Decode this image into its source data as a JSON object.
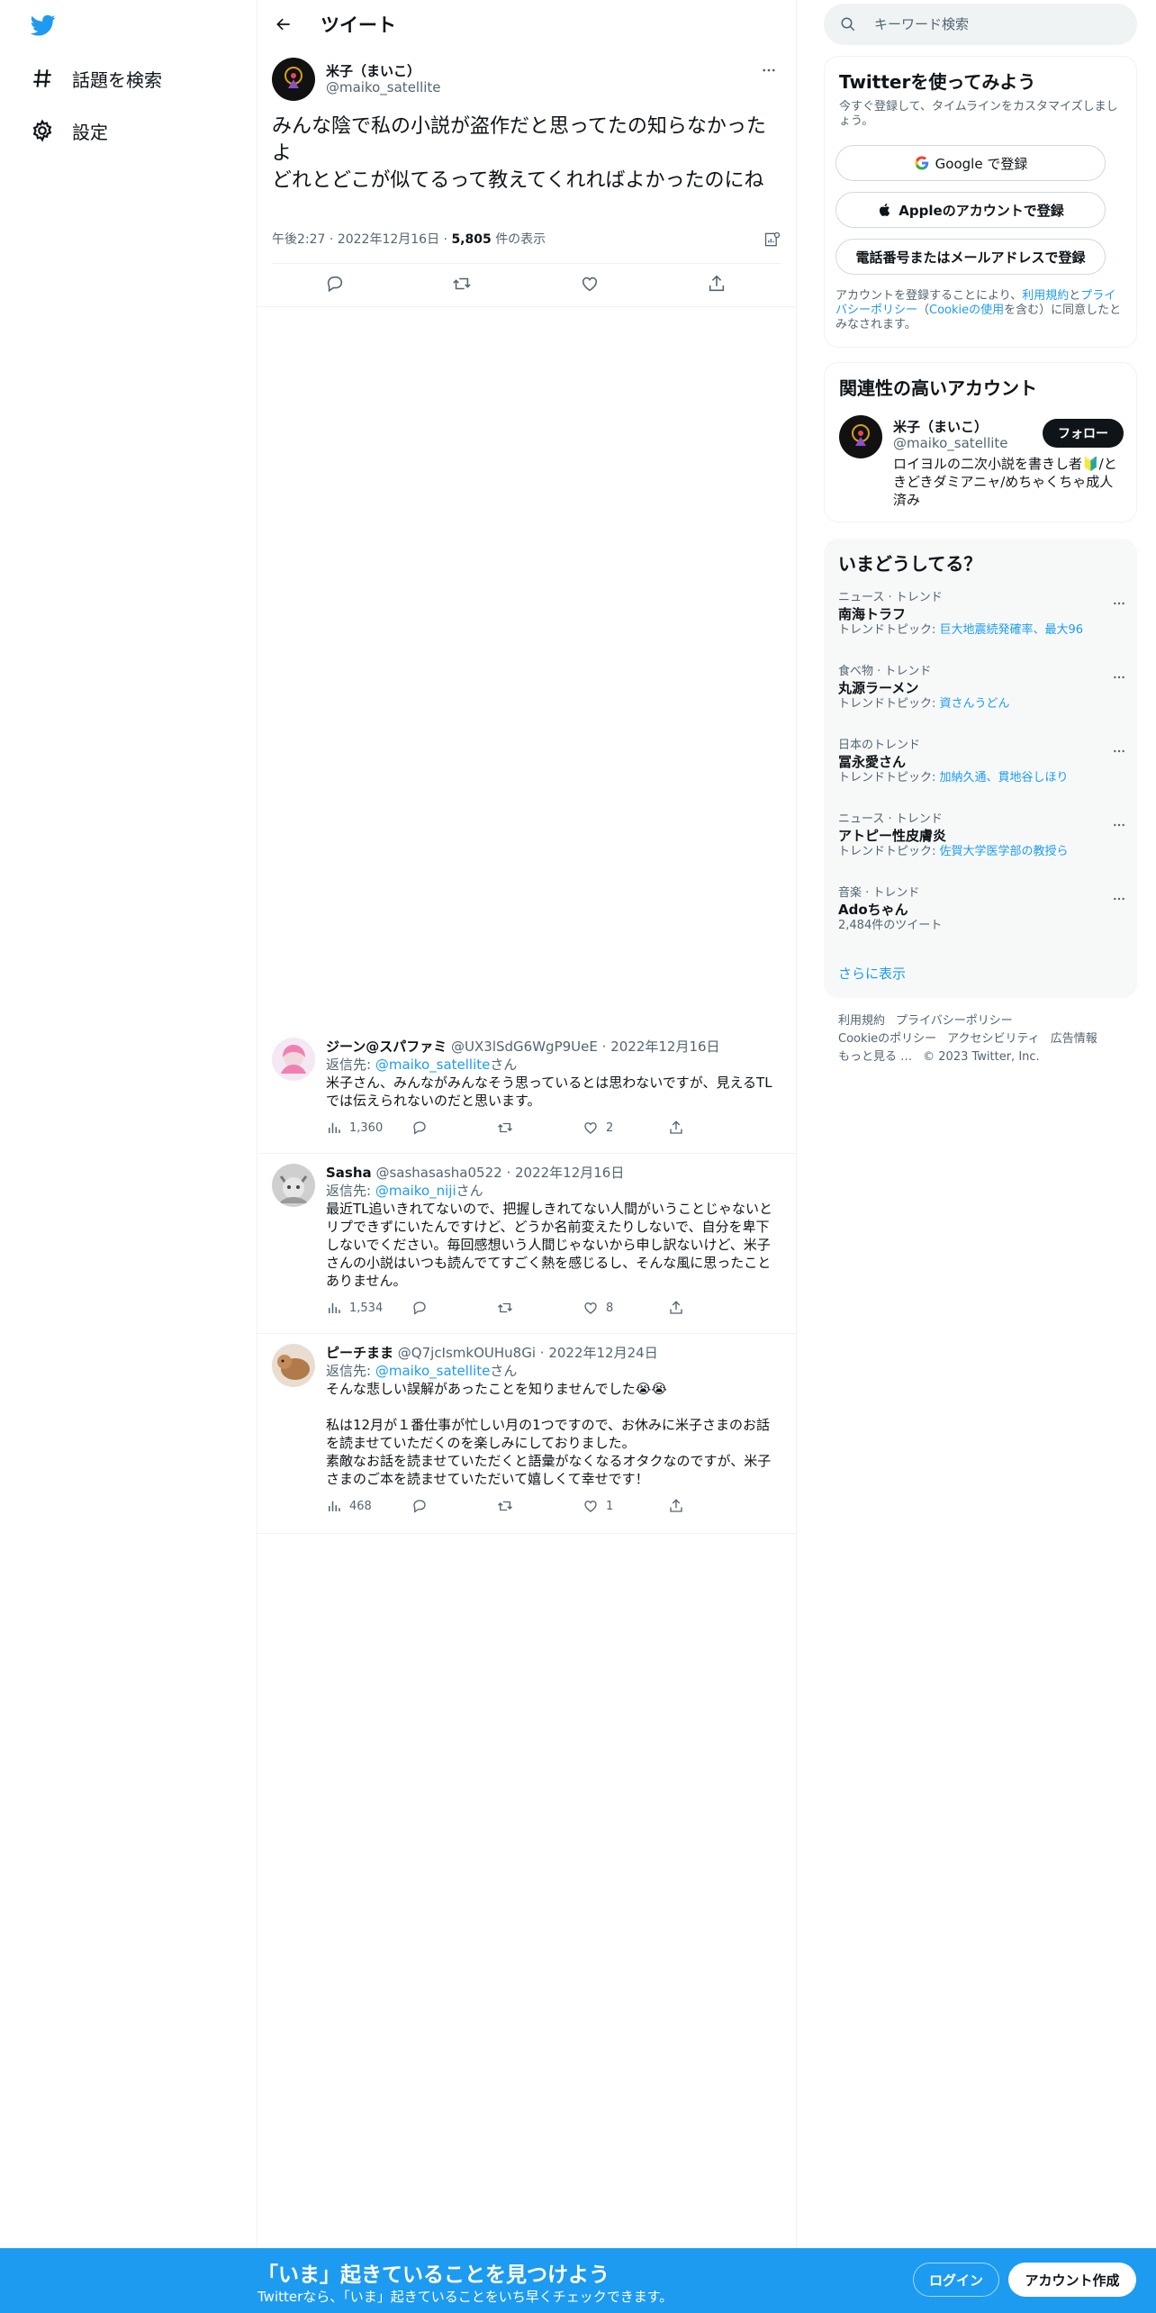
{
  "colors": {
    "brand": "#1d9bf0",
    "text": "#0f1419",
    "muted": "#536471"
  },
  "nav": {
    "items": [
      {
        "label": "話題を検索",
        "icon": "hashtag-icon"
      },
      {
        "label": "設定",
        "icon": "gear-icon"
      }
    ]
  },
  "header": {
    "title": "ツイート"
  },
  "tweet": {
    "name": "米子（まいこ）",
    "handle": "@maiko_satellite",
    "text": "みんな陰で私の小説が盗作だと思ってたの知らなかったよ\nどれとどこが似てるって教えてくれればよかったのにね",
    "time": "午後2:27",
    "date": "2022年12月16日",
    "views_count": "5,805",
    "views_label": "件の表示"
  },
  "replies": [
    {
      "name": "ジーン@スパファミ",
      "handle": "@UX3lSdG6WgP9UeE",
      "date": "2022年12月16日",
      "reply_to_label": "返信先: ",
      "reply_to": "@maiko_satellite",
      "reply_to_suffix": "さん",
      "text": "米子さん、みんながみんなそう思っているとは思わないですが、見えるTLでは伝えられないのだと思います。",
      "views": "1,360",
      "likes": "2"
    },
    {
      "name": "Sasha",
      "handle": "@sashasasha0522",
      "date": "2022年12月16日",
      "reply_to_label": "返信先: ",
      "reply_to": "@maiko_niji",
      "reply_to_suffix": "さん",
      "text": "最近TL追いきれてないので、把握しきれてない人間がいうことじゃないとリプできずにいたんですけど、どうか名前変えたりしないで、自分を卑下しないでください。毎回感想いう人間じゃないから申し訳ないけど、米子さんの小説はいつも読んでてすごく熱を感じるし、そんな風に思ったことありません。",
      "views": "1,534",
      "likes": "8"
    },
    {
      "name": "ピーチまま",
      "handle": "@Q7jcIsmkOUHu8Gi",
      "date": "2022年12月24日",
      "reply_to_label": "返信先: ",
      "reply_to": "@maiko_satellite",
      "reply_to_suffix": "さん",
      "text": "そんな悲しい誤解があったことを知りませんでした😭😭\n\n私は12月が１番仕事が忙しい月の1つですので、お休みに米子さまのお話を読ませていただくのを楽しみにしておりました。\n素敵なお話を読ませていただくと語彙がなくなるオタクなのですが、米子さまのご本を読ませていただいて嬉しくて幸せです！",
      "views": "468",
      "likes": "1"
    }
  ],
  "search": {
    "placeholder": "キーワード検索"
  },
  "signup": {
    "title": "Twitterを使ってみよう",
    "subtitle": "今すぐ登録して、タイムラインをカスタマイズしましょう。",
    "google": "Google で登録",
    "apple": "Appleのアカウントで登録",
    "email": "電話番号またはメールアドレスで登録",
    "legal_1": "アカウントを登録することにより、",
    "legal_terms": "利用規約",
    "legal_2": "と",
    "legal_privacy": "プライバシーポリシー",
    "legal_3": "（",
    "legal_cookie": "Cookieの使用",
    "legal_4": "を含む）に同意したとみなされます。"
  },
  "related": {
    "title": "関連性の高いアカウント",
    "name": "米子（まいこ）",
    "handle": "@maiko_satellite",
    "follow": "フォロー",
    "bio": "ロイヨルの二次小説を書きし者🔰/ときどきダミアニャ/めちゃくちゃ成人済み"
  },
  "trends": {
    "title": "いまどうしてる？",
    "items": [
      {
        "category": "ニュース · トレンド",
        "title": "南海トラフ",
        "topic_label": "トレンドトピック: ",
        "topic": "巨大地震続発確率、最大96"
      },
      {
        "category": "食べ物 · トレンド",
        "title": "丸源ラーメン",
        "topic_label": "トレンドトピック: ",
        "topic": "資さんうどん"
      },
      {
        "category": "日本のトレンド",
        "title": "冨永愛さん",
        "topic_label": "トレンドトピック: ",
        "topic": "加納久通、貫地谷しほり"
      },
      {
        "category": "ニュース · トレンド",
        "title": "アトピー性皮膚炎",
        "topic_label": "トレンドトピック: ",
        "topic": "佐賀大学医学部の教授ら"
      },
      {
        "category": "音楽 · トレンド",
        "title": "Adoちゃん",
        "topic_label": "",
        "topic": "2,484件のツイート"
      }
    ],
    "show_more": "さらに表示"
  },
  "footer": {
    "links": [
      "利用規約",
      "プライバシーポリシー",
      "Cookieのポリシー",
      "アクセシビリティ",
      "広告情報",
      "もっと見る …"
    ],
    "copyright": "© 2023 Twitter, Inc."
  },
  "banner": {
    "headline": "「いま」起きていることを見つけよう",
    "sub": "Twitterなら、「いま」起きていることをいち早くチェックできます。",
    "login": "ログイン",
    "signup": "アカウント作成"
  }
}
